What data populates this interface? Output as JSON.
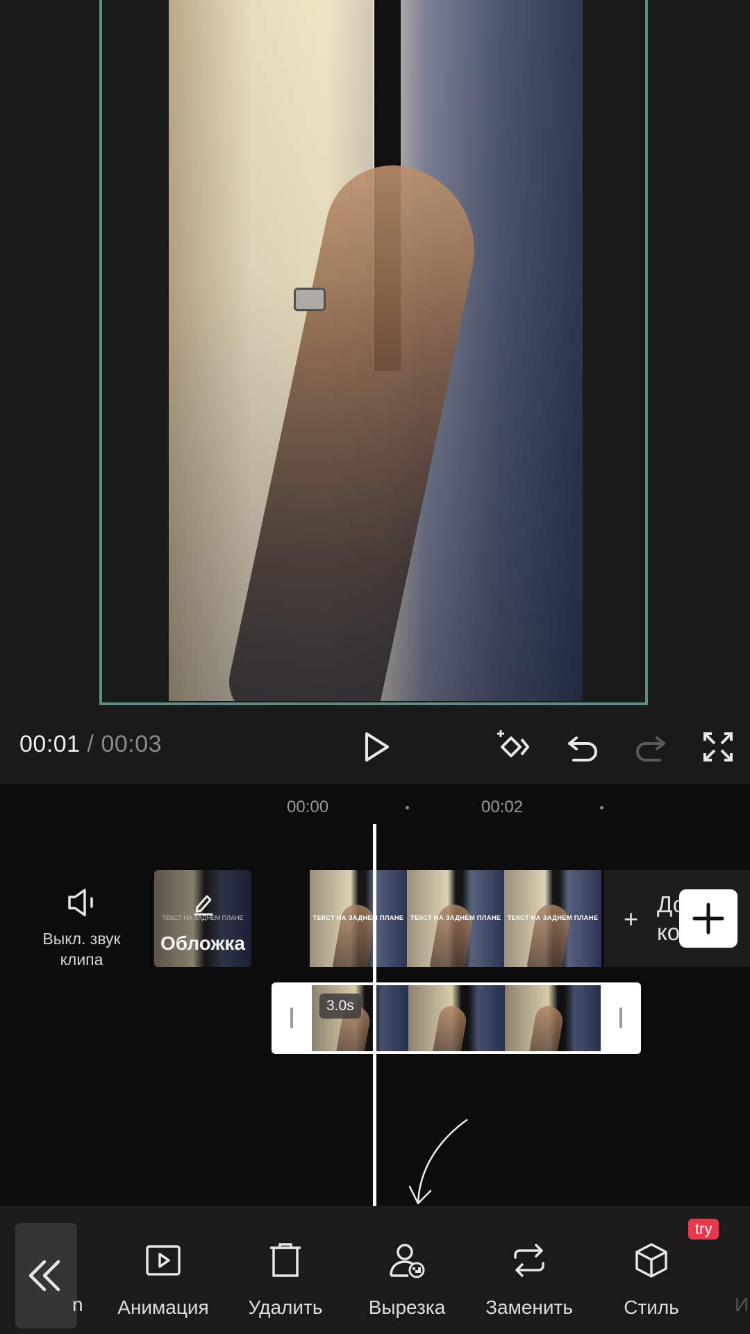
{
  "player": {
    "current_time": "00:01",
    "separator": "/",
    "total_time": "00:03"
  },
  "timeline": {
    "ruler": [
      "00:00",
      "00:02"
    ],
    "mute_label_line1": "Выкл. звук",
    "mute_label_line2": "клипа",
    "cover_label": "Обложка",
    "clip_text": "ТЕКСТ НА ЗАДНЕМ ПЛАНЕ",
    "add_clip_line1": "Доба",
    "add_clip_line2": "конц",
    "overlay_duration": "3.0s"
  },
  "toolbar": {
    "left_partial": "n",
    "tools": [
      "Анимация",
      "Удалить",
      "Вырезка",
      "Заменить",
      "Стиль"
    ],
    "right_partial": "И",
    "try_badge": "try"
  },
  "colors": {
    "frame_border": "#5e8c86",
    "try_badge": "#e53a4e",
    "toolbar_bg": "#1b1b1b"
  }
}
